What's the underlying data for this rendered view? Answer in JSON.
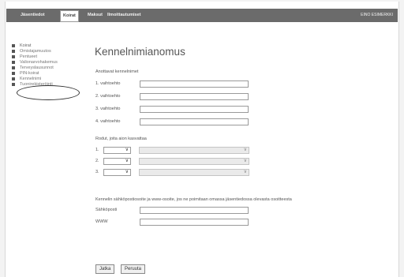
{
  "nav": {
    "tabs": [
      "Jäsentiedot",
      "Koirat",
      "Maksut",
      "Ilmoittautumiset"
    ],
    "user": "EINO ESIMERKKI"
  },
  "sidebar": {
    "items": [
      "Koirat",
      "Omistajamuutos",
      "Pentueet",
      "Valionarvohakemus",
      "Terveyslausunnot",
      "PIN-koirat",
      "Kennelnimi",
      "Tuonirekisteröinti"
    ]
  },
  "form": {
    "title": "Kennelnimianomus",
    "names_heading": "Anottavat kennelnimet",
    "name_labels": [
      "1. vaihtoehto",
      "2. vaihtoehto",
      "3. vaihtoehto",
      "4. vaihtoehto"
    ],
    "breeds_heading": "Rodut, joita aion kasvattaa",
    "breed_labels": [
      "1.",
      "2.",
      "3."
    ],
    "contact_heading": "Kennelin sähköpostiosoite ja www-osoite, jos ne poimitaan omassa jäsentiedossa olevasta osoitteesta",
    "email_label": "Sähköposti",
    "www_label": "WWW",
    "continue_label": "Jatka",
    "cancel_label": "Peruuta"
  }
}
